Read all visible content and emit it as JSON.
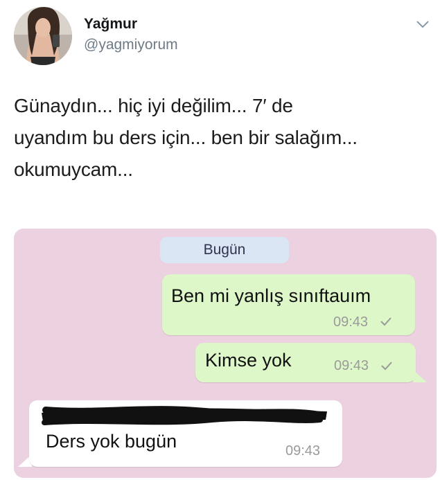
{
  "user": {
    "name": "Yağmur",
    "handle": "@yagmiyorum"
  },
  "tweet": {
    "lines": [
      "Günaydın... hiç iyi değilim... 7′ de",
      "uyandım bu ders için... ben bir salağım...",
      "okumuycam..."
    ]
  },
  "chat": {
    "date_label": "Bugün",
    "messages": [
      {
        "direction": "outgoing",
        "text": "Ben mi yanlış sınıftauım",
        "time": "09:43",
        "status": "sent-check-icon"
      },
      {
        "direction": "outgoing",
        "text": "Kimse yok",
        "time": "09:43",
        "status": "sent-check-icon"
      },
      {
        "direction": "incoming",
        "text": "Ders yok bugün",
        "time": "09:43"
      }
    ]
  },
  "colors": {
    "chat_background": "#ecd1e0",
    "outgoing_bubble": "#ddf7c8",
    "incoming_bubble": "#ffffff",
    "date_pill": "#dbe6f5",
    "handle_text": "#6e7b86"
  },
  "icons": {
    "menu": "chevron-down-icon",
    "read_status": "check-icon"
  }
}
